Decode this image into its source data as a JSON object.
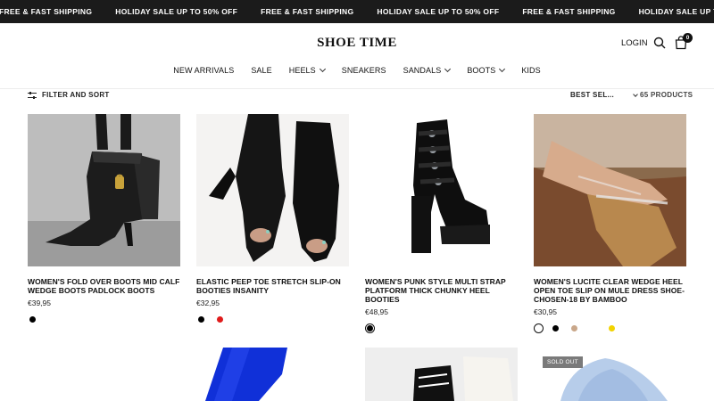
{
  "announcement": {
    "items": [
      "FREE & FAST SHIPPING",
      "HOLIDAY SALE UP TO 50% OFF",
      "FREE & FAST SHIPPING",
      "HOLIDAY SALE UP TO 50% OFF",
      "FREE & FAST SHIPPING",
      "HOLIDAY SALE UP TO 50% OFF"
    ]
  },
  "header": {
    "logo": "SHOE TIME",
    "login": "LOGIN",
    "cart_count": "0",
    "icons": [
      "search-icon",
      "cart-icon"
    ]
  },
  "nav": {
    "items": [
      {
        "label": "NEW ARRIVALS",
        "dropdown": false
      },
      {
        "label": "SALE",
        "dropdown": false
      },
      {
        "label": "HEELS",
        "dropdown": true
      },
      {
        "label": "SNEAKERS",
        "dropdown": false
      },
      {
        "label": "SANDALS",
        "dropdown": true
      },
      {
        "label": "BOOTS",
        "dropdown": true
      },
      {
        "label": "KIDS",
        "dropdown": false
      }
    ]
  },
  "toolbar": {
    "filter_label": "FILTER AND SORT",
    "sort_label": "BEST SEL...",
    "product_count": "65 PRODUCTS"
  },
  "products": [
    {
      "title": "WOMEN'S FOLD OVER BOOTS MID CALF WEDGE BOOTS PADLOCK BOOTS",
      "price": "€39,95",
      "swatches": [
        "#000000"
      ]
    },
    {
      "title": "ELASTIC PEEP TOE STRETCH SLIP-ON BOOTIES INSANITY",
      "price": "€32,95",
      "swatches": [
        "#000000",
        "#e01b1b"
      ]
    },
    {
      "title": "WOMEN'S PUNK STYLE MULTI STRAP PLATFORM THICK CHUNKY HEEL BOOTIES",
      "price": "€48,95",
      "swatches": [
        "#000000"
      ]
    },
    {
      "title": "WOMEN'S LUCITE CLEAR WEDGE HEEL OPEN TOE SLIP ON MULE DRESS SHOE-CHOSEN-18 BY BAMBOO",
      "price": "€30,95",
      "swatches": [
        "#ffffff",
        "#000000",
        "#c9a78a",
        "#ffffff",
        "#f2d300"
      ]
    }
  ],
  "second_row": {
    "sold_out_badge": "SOLD OUT"
  },
  "colors": {
    "announcement_bg": "#1b1b1b",
    "text": "#111111"
  }
}
